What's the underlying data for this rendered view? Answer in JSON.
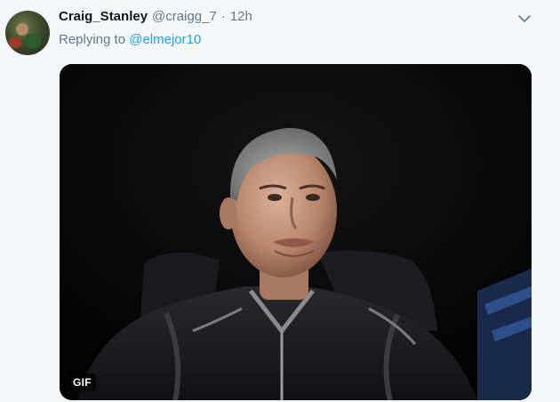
{
  "tweet": {
    "author_name": "Craig_Stanley",
    "author_handle": "@craigg_7",
    "separator": "·",
    "timestamp": "12h",
    "reply_prefix": "Replying to",
    "reply_to_handle": "@elmejor10",
    "media": {
      "type": "gif",
      "badge": "GIF"
    }
  },
  "icons": {
    "menu": "chevron-down-icon"
  },
  "colors": {
    "background": "#f5f8fa",
    "link": "#1da1f2",
    "secondary_text": "#657786",
    "primary_text": "#14171a"
  }
}
